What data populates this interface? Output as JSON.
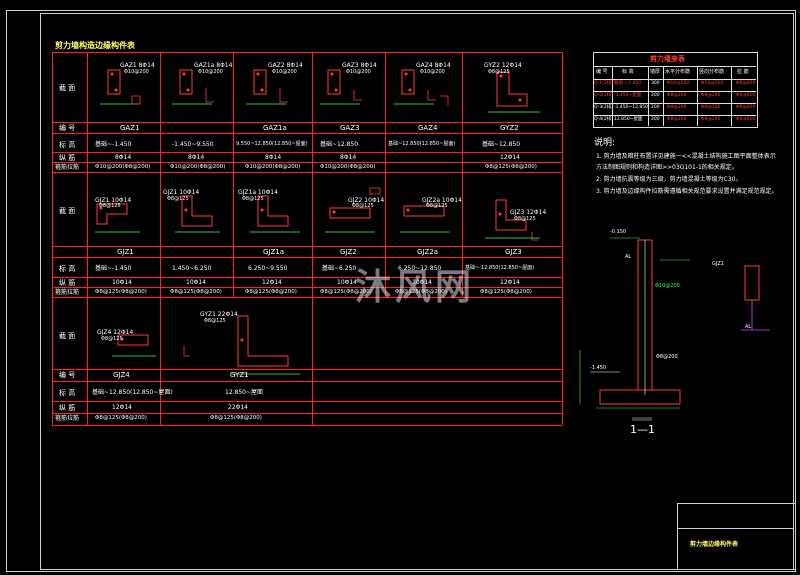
{
  "sheet_title": "剪力墙构造边缘构件表",
  "titleblock_name": "剪力墙边缘构件表",
  "watermark": "沐风网",
  "row_labels": {
    "section": "截 面",
    "id": "编 号",
    "elev": "标 高",
    "long": "纵 筋",
    "stir": "箍筋拉筋"
  },
  "group1": {
    "cells": [
      {
        "tag": "GAZ1 8Φ14",
        "sub": "Φ10@200"
      },
      {
        "tag": "GAZ1a 8Φ14",
        "sub": "Φ10@200"
      },
      {
        "tag": "GAZ2 8Φ14",
        "sub": "Φ10@200"
      },
      {
        "tag": "GAZ3 8Φ14",
        "sub": "Φ10@200"
      },
      {
        "tag": "GAZ4 8Φ14",
        "sub": "Φ10@200"
      },
      {
        "tag": "GYZ2 12Φ14",
        "sub": "Φ8@125"
      }
    ],
    "ids": [
      "GAZ1",
      "GAZ1a",
      "GAZ3",
      "GAZ4",
      "GYZ2"
    ],
    "elevs": [
      "基础~-1.450",
      "-1.450~9.550",
      "9.550~12.850(12.850~屋面)",
      "基础~12.850",
      "基础~12.850(12.850~屋面)",
      "基础~12.850"
    ],
    "longs": [
      "8Φ14",
      "8Φ14",
      "8Φ14",
      "8Φ14",
      "12Φ14"
    ],
    "stirs": [
      "Φ10@200(Φ8@200)",
      "Φ10@200(Φ8@200)",
      "Φ10@200(Φ8@200)",
      "Φ10@200(Φ8@200)",
      "Φ8@125(Φ8@200)"
    ]
  },
  "group2": {
    "cells": [
      {
        "tag": "GJZ1 10Φ14",
        "sub": "Φ8@125"
      },
      {
        "tag": "GJZ1 10Φ14",
        "sub": "Φ8@125"
      },
      {
        "tag": "GJZ1a 10Φ14",
        "sub": "Φ8@125"
      },
      {
        "tag": "GJZ2 10Φ14",
        "sub": "Φ8@125"
      },
      {
        "tag": "GJZ2a 10Φ14",
        "sub": "Φ8@125"
      },
      {
        "tag": "GJZ3 12Φ14",
        "sub": "Φ8@125"
      }
    ],
    "ids": [
      "GJZ1",
      "GJZ1a",
      "GJZ2",
      "GJZ2a",
      "GJZ3"
    ],
    "elevs": [
      "基础~-1.450",
      "1.450~6.250",
      "6.250~9.550",
      "基础~6.250",
      "6.250~12.850",
      "基础~-12.850(12.850~屋面)"
    ],
    "longs": [
      "10Φ14",
      "10Φ14",
      "12Φ14",
      "10Φ14",
      "10Φ14",
      "12Φ14"
    ],
    "stirs": [
      "Φ8@125(Φ8@200)",
      "Φ8@125(Φ8@200)",
      "Φ8@125(Φ8@200)",
      "Φ8@125(Φ8@200)",
      "Φ8@125(Φ8@200)",
      "Φ8@125(Φ8@200)"
    ]
  },
  "group3": {
    "cells": [
      {
        "tag": "GJZ4 12Φ14",
        "sub": "Φ8@125"
      },
      {
        "tag": "GYZ1 22Φ14",
        "sub": "Φ8@125"
      }
    ],
    "ids": [
      "GJZ4",
      "GYZ1"
    ],
    "elevs": [
      "基础~12.850(12.850~屋面)",
      "12.850~屋面"
    ],
    "longs": [
      "12Φ14",
      "22Φ14"
    ],
    "stirs": [
      "Φ8@125(Φ8@200)",
      "Φ8@125(Φ8@200)"
    ]
  },
  "legend": {
    "title": "剪力墙身表",
    "headers": [
      "编 号",
      "标 高",
      "墙厚",
      "水平分布筋",
      "竖向分布筋",
      "拉 筋"
    ],
    "rows": [
      [
        "Q-1(2排)",
        "基础~-1.450",
        "300",
        "Φ10@200",
        "Φ10@200",
        "Φ6@600"
      ],
      [
        "Q-2(2排)",
        "-1.450~屋面",
        "200",
        "Φ8@200",
        "Φ8@200",
        "Φ6@600"
      ],
      [
        "Q-3(2排)",
        "-1.450~12.850",
        "200",
        "Φ8@200",
        "Φ8@200",
        "Φ6@600"
      ],
      [
        "Q-4(2排)",
        "12.850~屋面",
        "200",
        "Φ8@200",
        "Φ8@200",
        "Φ6@600"
      ]
    ]
  },
  "notes": {
    "title": "说明:",
    "items": [
      "1. 剪力墙及暗柱布置详见建施一<<混凝土结构施工图平面整体表示",
      "   方法制图规则和构造详图>>03G101-1的相关规定。",
      "2. 剪力墙抗震等级为三级，剪力墙混凝土等级为C30。",
      "3. 剪力墙及边缘构件拉筋需遵循相关规范要求设置并满足规范规定。"
    ]
  },
  "section_mark": "1—1",
  "section_labels": {
    "top_elev": "-0.150",
    "al": "AL",
    "mid": "Φ10@200",
    "bottom": "-1.450",
    "rebar_right": "Φ8@200",
    "slab_tag": "GJZ1",
    "al2": "AL"
  }
}
